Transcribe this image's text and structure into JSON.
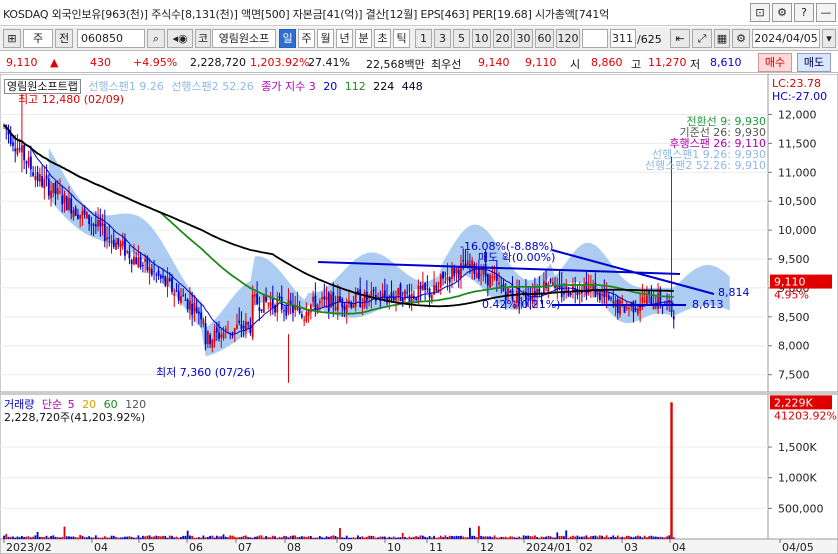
{
  "window": {
    "title": "KOSDAQ 외국인보유[963(천)] 주식수[8,131(천)] 액면[500] 자본금[41(억)] 결산[12월] EPS[463] PER[19.68] 시가총액[741억",
    "buttons": [
      "⊡",
      "⚙",
      "?",
      "—"
    ]
  },
  "toolbar": {
    "prefix": "주",
    "jeon": "전",
    "code": "060850",
    "kw": "코",
    "name": "영림원소프",
    "periods": [
      "일",
      "주",
      "월",
      "년",
      "분",
      "초",
      "틱"
    ],
    "numbers": [
      "1",
      "3",
      "5",
      "10",
      "20",
      "30",
      "60",
      "120"
    ],
    "count": "311",
    "total": "625",
    "date": "2024/04/05"
  },
  "price": {
    "current": "9,110",
    "arrow": "▲",
    "change": "430",
    "pct": "+4.95%",
    "volume": "2,228,720",
    "vol_ratio": "1,203.92%",
    "turnover": "27.41%",
    "amount": "22,568백만",
    "best_label": "최우선",
    "best_ask": "9,140",
    "best_bid": "9,110",
    "open_label": "시",
    "open": "8,860",
    "high_label": "고",
    "high": "11,270",
    "low_label": "저",
    "low": "8,610",
    "buy": "매수",
    "sell": "매도"
  },
  "legend": {
    "name": "영림원소프트랩",
    "sp1": "선행스팬1 9.26",
    "sp2": "선행스팬2 52.26",
    "ma_label": "종가 지수 3",
    "ma20": "20",
    "ma112": "112",
    "ma224": "224",
    "ma448": "448",
    "lc": "LC:23.78",
    "hc": "HC:-27.00",
    "high_note": "최고 12,480 (02/09)",
    "low_note": "최저 7,360 (07/26)"
  },
  "ichimoku_list": [
    "전환선 9: 9,930",
    "기준선 26: 9,930",
    "후행스팬 26: 9,110",
    "선행스팬1 9.26: 9,930",
    "선행스팬2 52.26: 9,910"
  ],
  "colors": {
    "up": "#e00000",
    "down": "#0000d0",
    "cloud": "#9dc3ef",
    "ma_long": "#000000",
    "ma_mid": "#1e8a1e",
    "ichi1": "#1d9a3a",
    "ichi2": "#555555",
    "ichi3": "#b000b0",
    "ichi4": "#8fb8e8",
    "ichi5": "#8fb8e8"
  },
  "annotations": {
    "drop": "-16.08%(-8.88%)",
    "box": "매도 확(0.00%)",
    "up": "0.42%(0.21%)",
    "line_tip": "8,814",
    "line_low": "8,613"
  },
  "chart_data": [
    {
      "type": "candlestick",
      "title": "영림원소프트랩",
      "y_axis": [
        "12,000",
        "11,500",
        "11,000",
        "10,500",
        "10,000",
        "9,500",
        "9,000",
        "8,500",
        "8,000",
        "7,500"
      ],
      "ylim": [
        7200,
        12700
      ],
      "x_labels": [
        "2023/02",
        "04",
        "05",
        "06",
        "07",
        "08",
        "09",
        "10",
        "11",
        "12",
        "2024/01",
        "02",
        "03",
        "04",
        "04/05"
      ],
      "last_price_label": "9,110",
      "last_pct_label": "4.95%",
      "high": 12480,
      "low": 7360,
      "last": 9110
    },
    {
      "type": "bar",
      "title": "거래량",
      "series_label": "단순",
      "ma": [
        "5",
        "20",
        "60",
        "120"
      ],
      "value_label": "2,228,720주(41,203.92%)",
      "y_axis": [
        "1,500K",
        "1,000K",
        "500,000"
      ],
      "ylim": [
        0,
        2300000
      ],
      "last_value_label": "2,229K",
      "last_pct_label": "41203.92%",
      "last": 2228720
    }
  ]
}
